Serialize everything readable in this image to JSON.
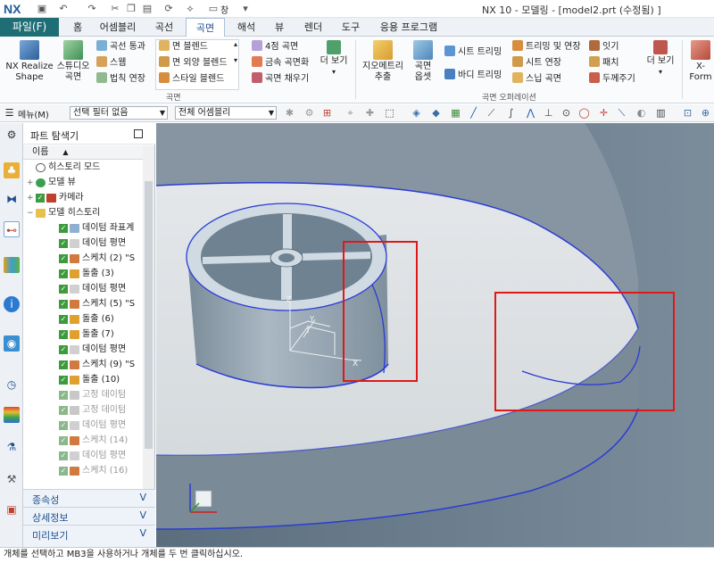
{
  "titlebar": {
    "logo": "NX",
    "window_menu": "창",
    "title": "NX 10 - 모델링 - [model2.prt (수정됨) ]"
  },
  "menubar": {
    "file": "파일(F)",
    "tabs": [
      "홈",
      "어셈블리",
      "곡선",
      "곡면",
      "해석",
      "뷰",
      "렌더",
      "도구",
      "응용 프로그램"
    ],
    "active": "곡면"
  },
  "ribbon": {
    "nx_realize": "NX Realize\nShape",
    "studio": "스튜디오\n곡면",
    "through_curves": "곡선 통과",
    "swept": "스웹",
    "law_extension": "법칙 연장",
    "face_blend": "면 블렌드",
    "face_shape_blend": "면 외양 블렌드",
    "style_blend": "스타일 블렌드",
    "four_point": "4점 곡면",
    "metal_surface": "금속 곡면화",
    "fill_surface": "곡면 채우기",
    "more1": "더 보기",
    "group1": "곡면",
    "geom_extract": "지오메트리\n추출",
    "offset_face": "곡면\n옵셋",
    "sheet_trim": "시트 트리밍",
    "body_trim": "바디 트리밍",
    "trim_extend": "트리밍 및 연장",
    "sheet_extend": "시트 연장",
    "snip_surface": "스닙 곡면",
    "sew": "잇기",
    "patch": "패치",
    "thicken": "두께주기",
    "more2": "더 보기",
    "group2": "곡면 오퍼레이션",
    "xform": "X-Form"
  },
  "toolbar": {
    "menu": "메뉴(M)",
    "selection_filter": "선택 필터 없음",
    "assembly_scope": "전체 어셈블리"
  },
  "navigator": {
    "title": "파트 탐색기",
    "column": "이름",
    "rows": [
      {
        "label": "히스토리 모드",
        "grey": false
      },
      {
        "label": "모델 뷰",
        "grey": false
      },
      {
        "label": "카메라",
        "grey": false
      },
      {
        "label": "모델 히스토리",
        "grey": false
      },
      {
        "label": "데이텀 좌표계",
        "grey": false
      },
      {
        "label": "데이텀 평면",
        "grey": false
      },
      {
        "label": "스케치 (2) \"S",
        "grey": false
      },
      {
        "label": "돌출 (3)",
        "grey": false
      },
      {
        "label": "데이텀 평면",
        "grey": false
      },
      {
        "label": "스케치 (5) \"S",
        "grey": false
      },
      {
        "label": "돌출 (6)",
        "grey": false
      },
      {
        "label": "돌출 (7)",
        "grey": false
      },
      {
        "label": "데이텀 평면",
        "grey": false
      },
      {
        "label": "스케치 (9) \"S",
        "grey": false
      },
      {
        "label": "돌출 (10)",
        "grey": false
      },
      {
        "label": "고정 데이텀",
        "grey": true
      },
      {
        "label": "고정 데이텀",
        "grey": true
      },
      {
        "label": "데이텀 평면",
        "grey": true
      },
      {
        "label": "스케치 (14)",
        "grey": true
      },
      {
        "label": "데이텀 평면",
        "grey": true
      },
      {
        "label": "스케치 (16)",
        "grey": true
      }
    ],
    "panels": [
      "종속성",
      "상세정보",
      "미리보기"
    ]
  },
  "viewport": {
    "axis_x": "X",
    "axis_y": "Y",
    "axis_z": "Z",
    "edge_color": "#2a3bd6",
    "highlight_color": "#e01818"
  },
  "status": "개체를 선택하고 MB3을 사용하거나 개체를 두 번 클릭하십시오."
}
